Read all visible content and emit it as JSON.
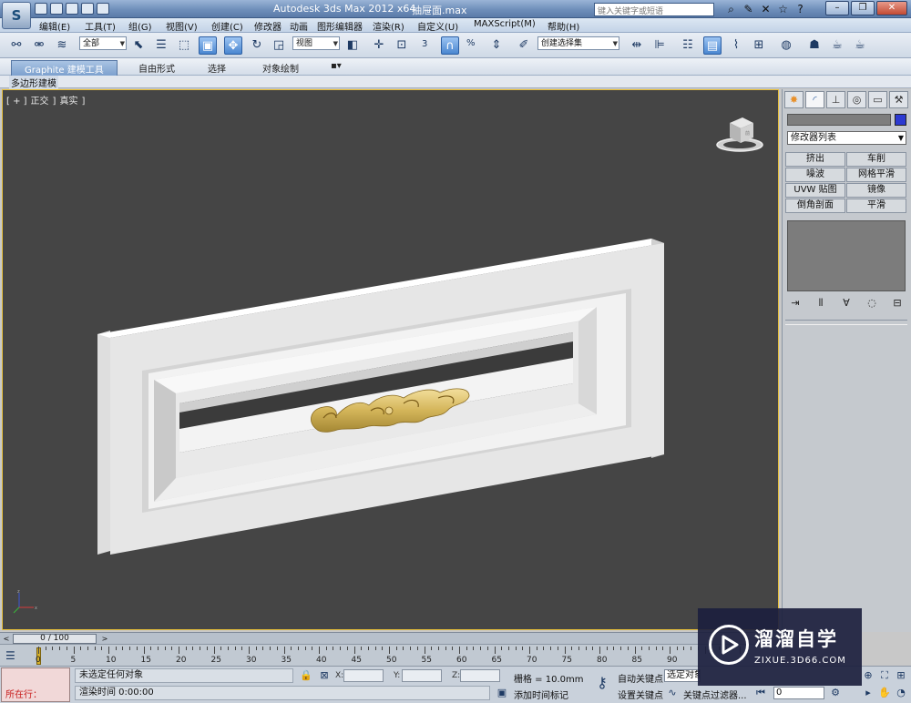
{
  "titlebar": {
    "title": "Autodesk 3ds Max  2012 x64",
    "file": "抽屉面.max",
    "search_placeholder": "键入关键字或短语",
    "icons": [
      "binoculars-icon",
      "wrench-icon",
      "star-icon",
      "help-icon"
    ],
    "window_buttons": [
      "minimize",
      "restore",
      "close"
    ]
  },
  "menu": {
    "items": [
      "编辑(E)",
      "工具(T)",
      "组(G)",
      "视图(V)",
      "创建(C)",
      "修改器",
      "动画",
      "图形编辑器",
      "渲染(R)",
      "自定义(U)",
      "MAXScript(M)",
      "帮助(H)"
    ]
  },
  "toolbar": {
    "selection_filter": "全部",
    "reference_coord": "视图",
    "snap_label": "3",
    "percent_label": "%",
    "named_selection": "创建选择集"
  },
  "ribbon": {
    "tabs": [
      "Graphite 建模工具",
      "自由形式",
      "选择",
      "对象绘制"
    ],
    "sub_label": "多边形建模"
  },
  "viewport": {
    "label_parts": [
      "[ + ]",
      "正交",
      "]",
      "真实",
      "]"
    ],
    "border_color": "#e8c03a",
    "background_color": "#454545"
  },
  "command_panel": {
    "modifier_list": "修改器列表",
    "buttons": [
      "挤出",
      "车削",
      "噪波",
      "网格平滑",
      "UVW 贴图",
      "镜像",
      "倒角剖面",
      "平滑"
    ],
    "object_color": "#2c3ad1"
  },
  "timeline": {
    "frame_display": "0 / 100",
    "ticks": [
      "0",
      "5",
      "10",
      "15",
      "20",
      "25",
      "30",
      "35",
      "40",
      "45",
      "50",
      "55",
      "60",
      "65",
      "70",
      "75",
      "80",
      "85",
      "90"
    ]
  },
  "statusbar": {
    "maxscript_label": "所在行：",
    "status_text": "未选定任何对象",
    "prompt_text": "渲染时间  0:00:00",
    "x_label": "X:",
    "y_label": "Y:",
    "z_label": "Z:",
    "grid_text": "栅格 = 10.0mm",
    "add_time_tag": "添加时间标记",
    "auto_key": "自动关键点",
    "set_key": "设置关键点",
    "key_mode": "选定对象",
    "key_filters": "关键点过滤器...",
    "frame_field": "0"
  },
  "watermark": {
    "title": "溜溜自学",
    "subtitle": "ZIXUE.3D66.COM"
  }
}
